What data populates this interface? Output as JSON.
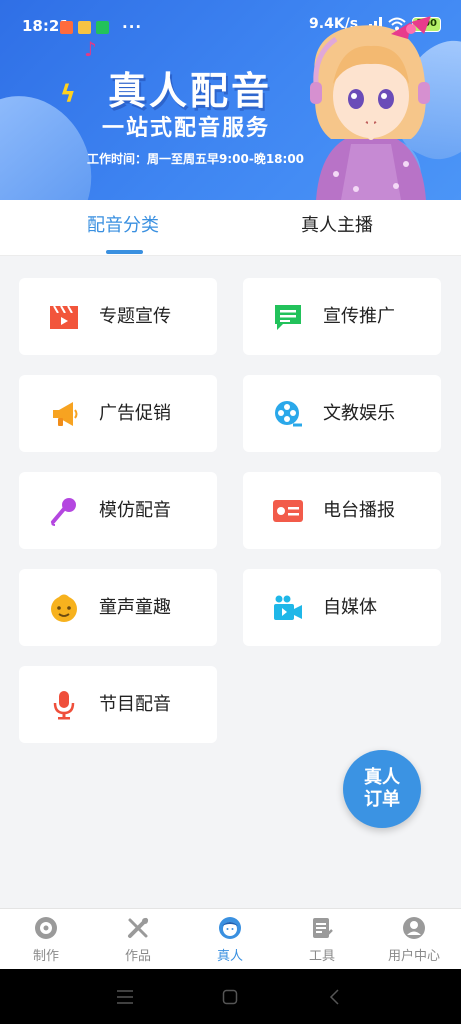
{
  "status_bar": {
    "time": "18:21",
    "more": "···",
    "speed": "9.4K/s",
    "battery": "100"
  },
  "banner": {
    "title": "真人配音",
    "subtitle": "一站式配音服务",
    "hours": "工作时间：周一至周五早9:00-晚18:00"
  },
  "tabs": [
    {
      "label": "配音分类",
      "active": true
    },
    {
      "label": "真人主播",
      "active": false
    }
  ],
  "categories": [
    {
      "label": "专题宣传",
      "icon": "clapperboard-icon",
      "color": "#f2553b"
    },
    {
      "label": "宣传推广",
      "icon": "message-icon",
      "color": "#22c25b"
    },
    {
      "label": "广告促销",
      "icon": "megaphone-icon",
      "color": "#f7a321"
    },
    {
      "label": "文教娱乐",
      "icon": "film-reel-icon",
      "color": "#2aa8ea"
    },
    {
      "label": "模仿配音",
      "icon": "microphone-icon",
      "color": "#b447e0"
    },
    {
      "label": "电台播报",
      "icon": "radio-card-icon",
      "color": "#f25b4a"
    },
    {
      "label": "童声童趣",
      "icon": "child-face-icon",
      "color": "#f7b21e"
    },
    {
      "label": "自媒体",
      "icon": "video-camera-icon",
      "color": "#1fb7e8"
    },
    {
      "label": "节目配音",
      "icon": "podcast-mic-icon",
      "color": "#ef4f3b"
    }
  ],
  "fab": {
    "line1": "真人",
    "line2": "订单"
  },
  "bottom_nav": [
    {
      "label": "制作",
      "icon": "disc-icon",
      "active": false
    },
    {
      "label": "作品",
      "icon": "tools-icon",
      "active": false
    },
    {
      "label": "真人",
      "icon": "person-icon",
      "active": true
    },
    {
      "label": "工具",
      "icon": "notepad-icon",
      "active": false
    },
    {
      "label": "用户中心",
      "icon": "user-circle-icon",
      "active": false
    }
  ],
  "colors": {
    "accent": "#3a90e0",
    "banner": "#3f86f2"
  }
}
